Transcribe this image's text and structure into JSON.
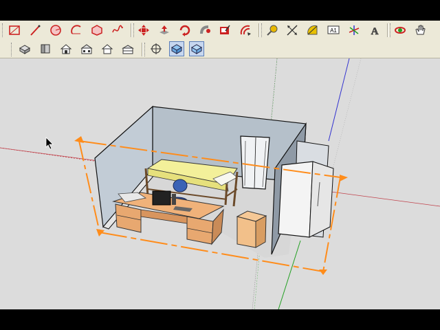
{
  "toolbar_top": {
    "groups": [
      [
        "rectangle-tool-icon",
        "line-tool-icon",
        "circle-tool-icon",
        "arc-tool-icon",
        "polygon-tool-icon",
        "freehand-tool-icon"
      ],
      [
        "move-tool-icon",
        "push-pull-tool-icon",
        "rotate-tool-icon",
        "follow-me-tool-icon",
        "scale-tool-icon",
        "offset-tool-icon"
      ],
      [
        "tape-measure-tool-icon",
        "dimension-tool-icon",
        "protractor-tool-icon",
        "text-tool-icon",
        "axes-tool-icon",
        "3d-text-tool-icon"
      ],
      [
        "orbit-tool-icon",
        "pan-tool-icon"
      ]
    ],
    "text_tool_glyph": "A1",
    "three_d_text_glyph": "A"
  },
  "toolbar_views": {
    "items": [
      "iso-view-icon",
      "top-view-icon",
      "front-view-icon",
      "right-view-icon",
      "back-view-icon",
      "left-view-icon"
    ],
    "style_items": [
      "xray-icon",
      "wireframe-style-icon",
      "shaded-style-icon"
    ],
    "active": [
      "wireframe-style-icon",
      "shaded-style-icon"
    ]
  },
  "colors": {
    "toolbar_bg": "#ece9d8",
    "viewport_bg": "#dcdcdc",
    "selection": "#ff8c1a",
    "axis_red": "#c0404a",
    "axis_green": "#22a022",
    "axis_blue": "#3030d0",
    "wall": "#a7b3c0",
    "floor": "#d9d9d9",
    "furniture": "#e8a870",
    "bedding": "#f3f09a"
  }
}
